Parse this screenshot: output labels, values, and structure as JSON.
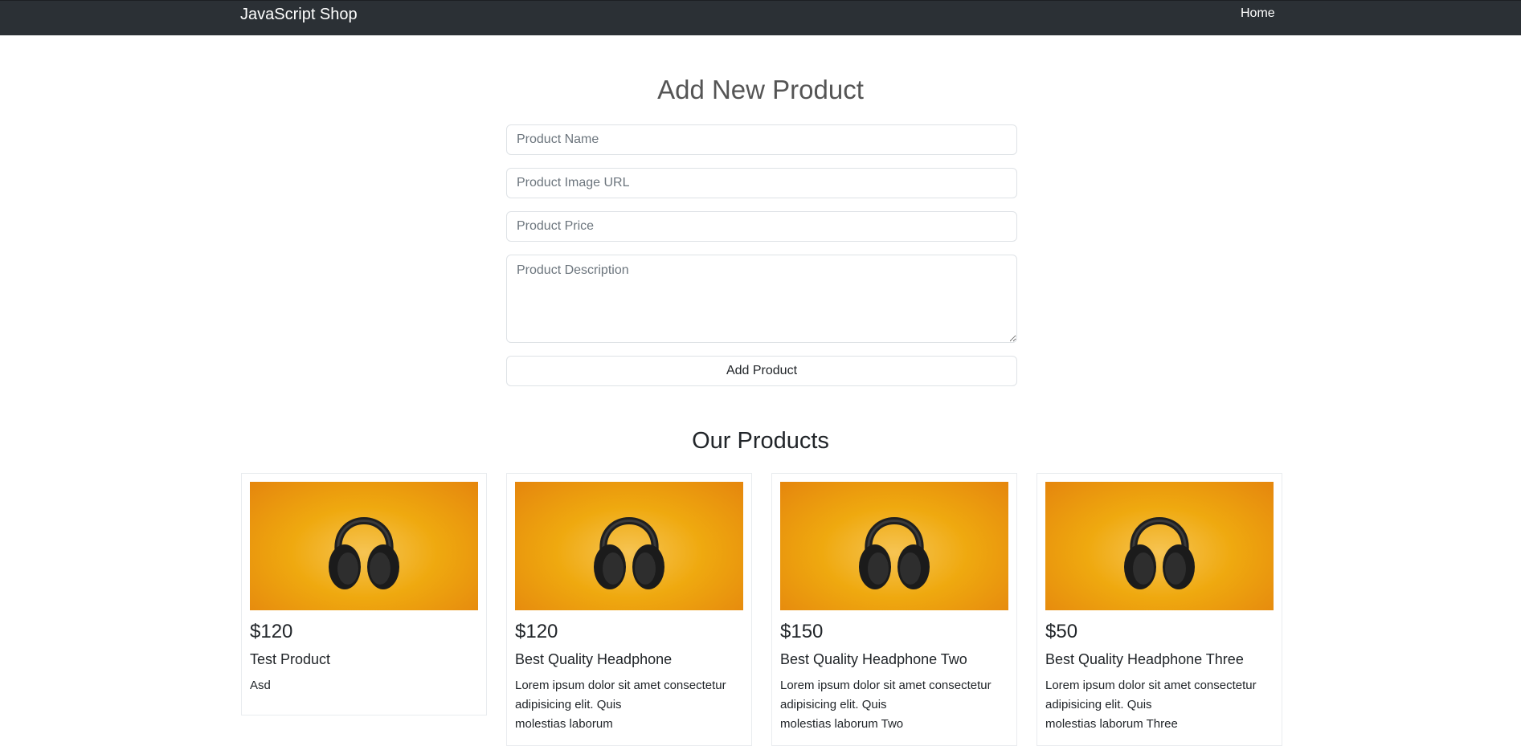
{
  "navbar": {
    "brand": "JavaScript Shop",
    "links": [
      {
        "label": "Home"
      }
    ]
  },
  "form": {
    "title": "Add New Product",
    "name_placeholder": "Product Name",
    "image_placeholder": "Product Image URL",
    "price_placeholder": "Product Price",
    "description_placeholder": "Product Description",
    "submit_label": "Add Product"
  },
  "products": {
    "title": "Our Products",
    "items": [
      {
        "price": "$120",
        "name": "Test Product",
        "desc_lines": [
          "Asd"
        ]
      },
      {
        "price": "$120",
        "name": "Best Quality Headphone",
        "desc_lines": [
          "Lorem ipsum dolor sit amet consectetur",
          "adipisicing elit. Quis",
          "molestias laborum"
        ]
      },
      {
        "price": "$150",
        "name": "Best Quality Headphone Two",
        "desc_lines": [
          "Lorem ipsum dolor sit amet consectetur",
          "adipisicing elit. Quis",
          "molestias laborum Two"
        ]
      },
      {
        "price": "$50",
        "name": "Best Quality Headphone Three",
        "desc_lines": [
          "Lorem ipsum dolor sit amet consectetur",
          "adipisicing elit. Quis",
          "molestias laborum Three"
        ]
      }
    ]
  },
  "colors": {
    "navbar_bg": "#2b3035",
    "image_bg": "#efa90f"
  },
  "icons": {
    "product_image": "headphones-icon"
  }
}
